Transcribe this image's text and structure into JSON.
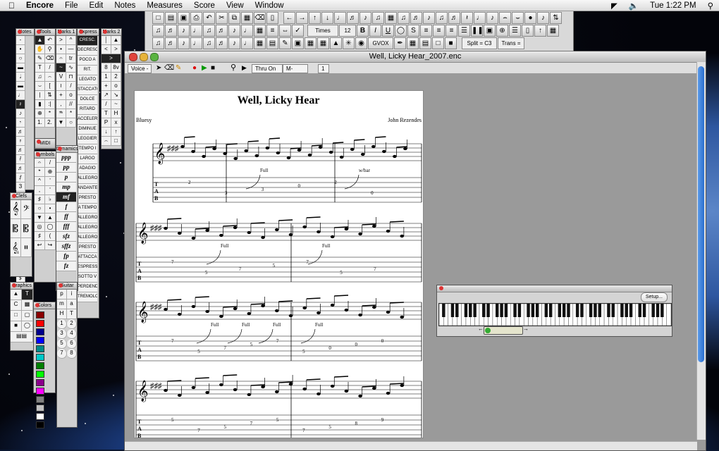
{
  "menubar": {
    "apple": "",
    "app": "Encore",
    "menus": [
      "File",
      "Edit",
      "Notes",
      "Measures",
      "Score",
      "View",
      "Window"
    ],
    "clock": "Tue 1:22 PM"
  },
  "toolbar": {
    "font_name": "Times",
    "font_size": "12",
    "bold": "B",
    "italic": "I",
    "underline": "U",
    "split": "Split = C3",
    "trans": "Trans =",
    "gvox": "GVOX"
  },
  "palettes": {
    "notes": "Notes",
    "tools": "Tools",
    "marks1": "Marks 1",
    "express": "Express",
    "marks2": "Marks 2",
    "midi": "MIDI",
    "dynamics": "Dynamics",
    "symbols": "Symbols",
    "clefs": "Clefs",
    "graphics": "Graphics",
    "colors": "Colors",
    "guitar": "Guitar",
    "express_terms": [
      "CRESC.",
      "DECRESC.",
      "POCO A",
      "RIT.",
      "LEGATO",
      "STACCATO",
      "DOLCE",
      "RITARD",
      "ACCELER",
      "DIMINUE",
      "LEGGIER",
      "TEMPO I",
      "LARGO",
      "ADAGIO",
      "ALLEGRO",
      "ANDANTE",
      "PRESTO",
      "A TEMPO",
      "ALLEGRO",
      "ALLEGRO",
      "ALLEGRO",
      "PRESTO",
      "ATTACCA",
      "ESPRESS",
      "SOTTO V",
      "PERDENDO",
      "TREMOLO"
    ],
    "dynamics_marks": [
      "ppp",
      "pp",
      "p",
      "mp",
      "mf",
      "f",
      "ff",
      "fff",
      "sfz",
      "sffz",
      "fp",
      "fz"
    ],
    "guitar_marks": [
      "p",
      "i",
      "m",
      "a",
      "H",
      "T",
      "1",
      "2",
      "3",
      "4",
      "5",
      "6",
      "7",
      "8"
    ],
    "clefs_glyph": "𝄞",
    "symbols_glyph": "𝄐",
    "colors_list": [
      "#8b0000",
      "#ff0000",
      "#00008b",
      "#0000ff",
      "#008b8b",
      "#00c8c8",
      "#008000",
      "#00ff00",
      "#8b008b",
      "#ff00ff",
      "#808080",
      "#c0c0c0",
      "#ffffff",
      "#000000"
    ]
  },
  "document": {
    "title": "Well, Licky Hear_2007.enc",
    "voice_label": "Voice -",
    "thru_label": "Thru On",
    "m_label": "M-",
    "page_number": "1"
  },
  "score": {
    "title": "Well, Licky Hear",
    "style": "Bluesy",
    "composer": "John Rezendes",
    "tab_letters": [
      "T",
      "A",
      "B"
    ],
    "annotations": [
      "Full",
      "w/bar",
      "Full",
      "Full",
      "Full",
      "Full",
      "Full",
      "Full"
    ],
    "tab_fragments": [
      [
        "2",
        "3",
        "3",
        "0",
        "2",
        "0"
      ],
      [
        "7",
        "5",
        "7",
        "5",
        "7",
        "5",
        "7"
      ],
      [
        "7",
        "5",
        "7",
        "2",
        "0",
        "0",
        "0"
      ],
      [
        "7",
        "5",
        "7",
        "5",
        "7",
        "5",
        "0",
        "0",
        "0"
      ],
      [
        "7",
        "5",
        "7",
        "5",
        "7",
        "5",
        "0",
        "0",
        "0"
      ],
      [
        "5",
        "7",
        "5",
        "7",
        "5",
        "7",
        "5",
        "8",
        "9"
      ]
    ]
  },
  "keyboard_window": {
    "setup_label": "Setup..."
  }
}
